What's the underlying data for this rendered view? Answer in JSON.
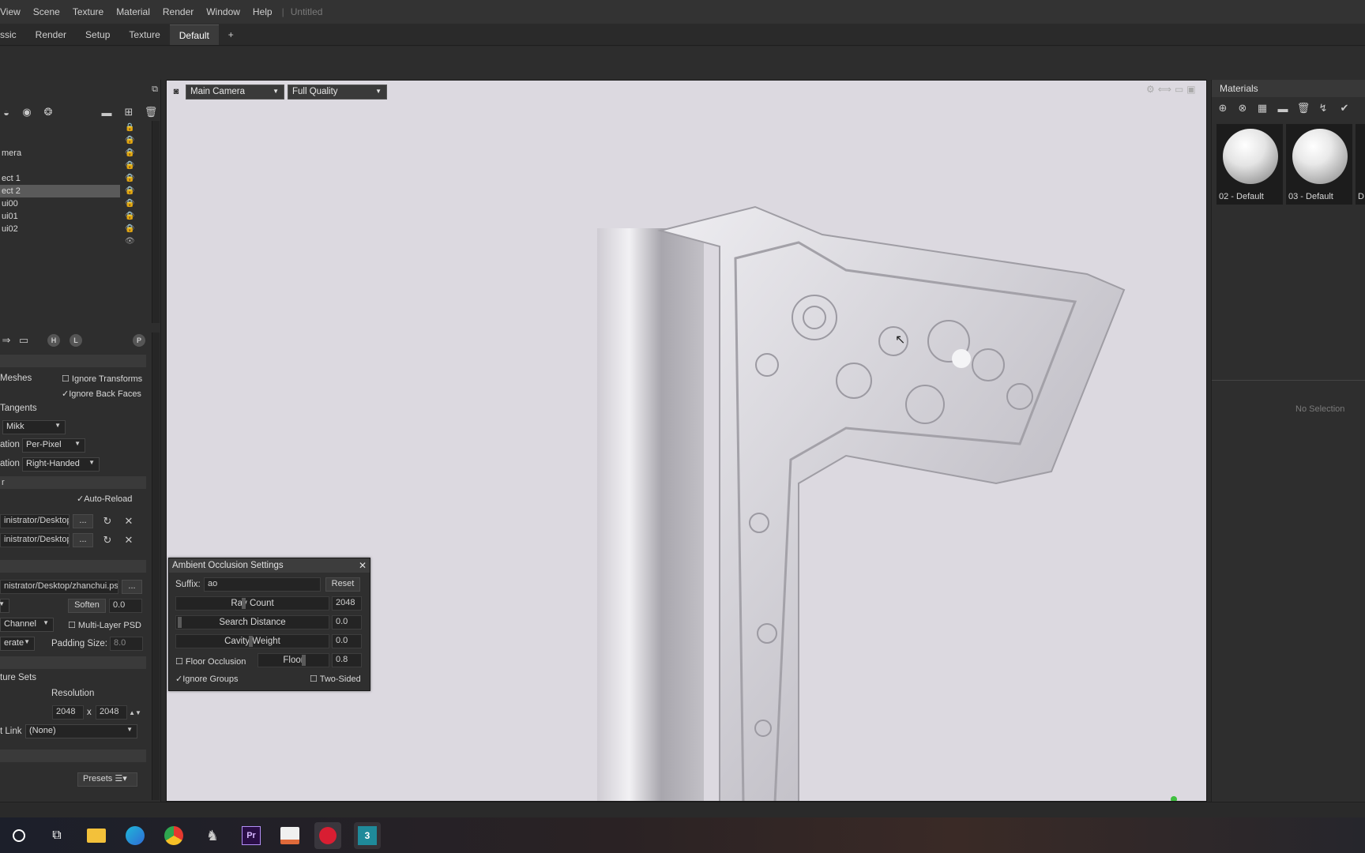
{
  "menu": {
    "items": [
      "View",
      "Scene",
      "Texture",
      "Material",
      "Render",
      "Window",
      "Help"
    ],
    "separator": "|",
    "doc_title": "Untitled"
  },
  "tabs": [
    "ssic",
    "Render",
    "Setup",
    "Texture",
    "Default",
    "+"
  ],
  "scene_list": {
    "rows": [
      "",
      "",
      "mera",
      "",
      "ect 1",
      "ect 2",
      "ui00",
      "ui01",
      "ui02"
    ],
    "selected_index": 5
  },
  "bake": {
    "letter_btns": [
      "H",
      "L",
      "P"
    ],
    "meshes_label": "Meshes",
    "ignore_transforms": "Ignore Transforms",
    "ignore_back_faces": "Ignore Back Faces",
    "tangents_label": "Tangents",
    "tangent_space": "Mikk",
    "orient_label_1": "ation",
    "orient_value_1": "Per-Pixel",
    "orient_label_2": "ation",
    "orient_value_2": "Right-Handed",
    "section_r": "r",
    "auto_reload": "Auto-Reload",
    "path1": "inistrator/Desktop",
    "path2": "inistrator/Desktop",
    "browse": "...",
    "output_path": "nistrator/Desktop/zhanchui.ps",
    "soften_label": "Soften",
    "soften_value": "0.0",
    "channel": "Channel",
    "multi_layer": "Multi-Layer PSD",
    "format": "erate",
    "padding_label": "Padding Size:",
    "padding_value": "8.0",
    "texture_sets": "ture Sets",
    "resolution_label": "Resolution",
    "res_w": "2048",
    "res_x": "x",
    "res_h": "2048",
    "link_label": "t Link",
    "link_value": "(None)",
    "presets": "Presets"
  },
  "viewport": {
    "camera": "Main Camera",
    "quality": "Full Quality"
  },
  "ao_dialog": {
    "title": "Ambient Occlusion Settings",
    "close": "✕",
    "suffix_label": "Suffix:",
    "suffix_value": "ao",
    "reset": "Reset",
    "ray_count_label": "Ray Count",
    "ray_count_value": "2048",
    "ray_count_level": 0.45,
    "search_distance_label": "Search Distance",
    "search_distance_value": "0.0",
    "cavity_weight_label": "Cavity Weight",
    "cavity_weight_value": "0.0",
    "floor_occlusion_label": "Floor Occlusion",
    "floor_label": "Floor",
    "floor_value": "0.8",
    "ignore_groups": "Ignore Groups",
    "two_sided": "Two-Sided"
  },
  "materials": {
    "title": "Materials",
    "items": [
      "02 - Default",
      "03 - Default",
      "D"
    ],
    "no_selection": "No Selection"
  },
  "colors": {
    "viewport_bg": "#dcd9e0",
    "panel_bg": "#2e2e2e",
    "selected_row": "#5a5a5a",
    "status_dot": "#3fbf3f"
  }
}
